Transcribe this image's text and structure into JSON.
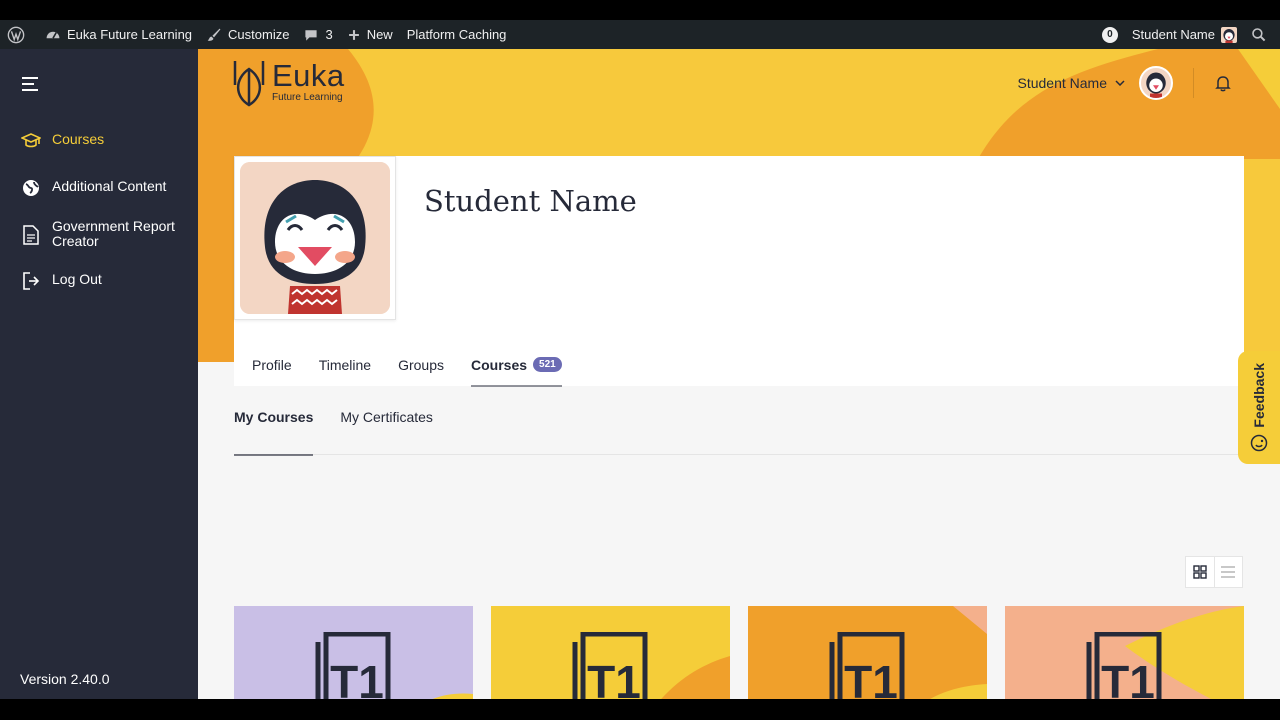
{
  "adminbar": {
    "site_name": "Euka Future Learning",
    "customize": "Customize",
    "comments_count": "3",
    "new_label": "New",
    "caching": "Platform Caching",
    "notif_count": "0",
    "user_name": "Student Name",
    "icons": [
      "wordpress-icon",
      "dashboard-icon",
      "brush-icon",
      "comment-icon",
      "plus-icon",
      "search-icon"
    ]
  },
  "sidebar": {
    "items": [
      {
        "label": "Courses",
        "icon": "graduation-cap-icon",
        "active": true
      },
      {
        "label": "Additional Content",
        "icon": "globe-icon",
        "active": false
      },
      {
        "label": "Government Report Creator",
        "icon": "document-icon",
        "active": false
      },
      {
        "label": "Log Out",
        "icon": "logout-icon",
        "active": false
      }
    ],
    "version": "Version 2.40.0"
  },
  "header": {
    "logo_name": "Euka",
    "logo_sub": "Future Learning",
    "user_name": "Student Name"
  },
  "profile": {
    "name": "Student Name",
    "tabs": [
      {
        "label": "Profile"
      },
      {
        "label": "Timeline"
      },
      {
        "label": "Groups"
      },
      {
        "label": "Courses",
        "count": "521",
        "active": true
      }
    ]
  },
  "subtabs": [
    {
      "label": "My Courses",
      "active": true
    },
    {
      "label": "My Certificates"
    }
  ],
  "feedback": {
    "label": "Feedback"
  },
  "colors": {
    "accent_yellow": "#f5cd39",
    "orange": "#f0a02b",
    "sidebar_bg": "#262a39",
    "badge": "#6b6bb4"
  },
  "course_cards": [
    {
      "icon_text": "T1",
      "theme": "lavender"
    },
    {
      "icon_text": "T1",
      "theme": "yellow"
    },
    {
      "icon_text": "T1",
      "theme": "orange"
    },
    {
      "icon_text": "T1",
      "theme": "peach"
    }
  ]
}
